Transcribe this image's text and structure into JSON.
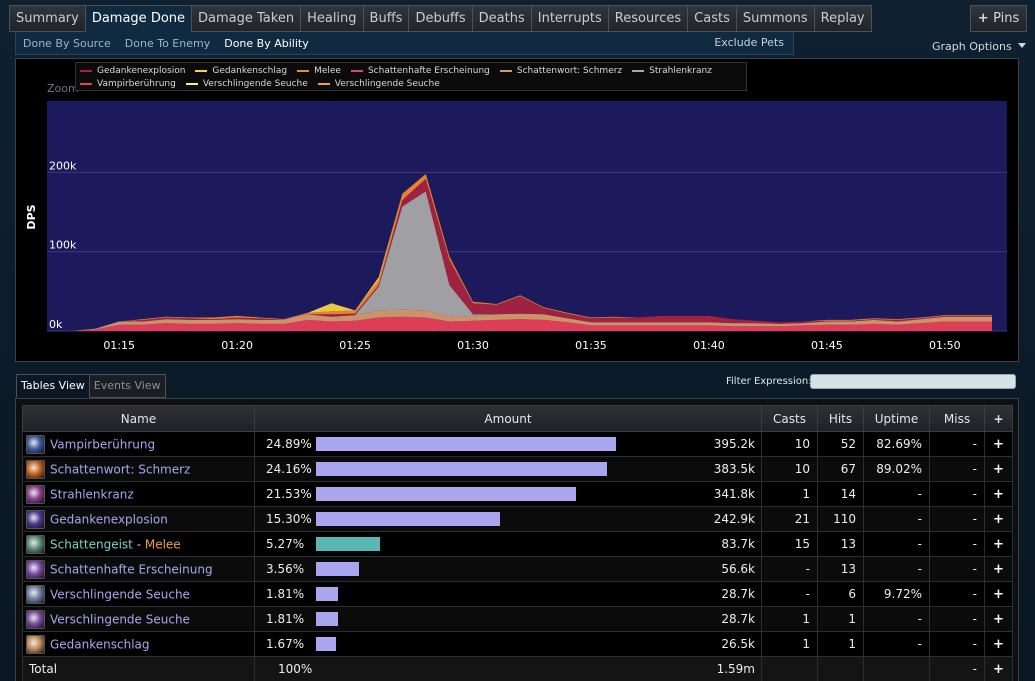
{
  "top_tabs": [
    "Summary",
    "Damage Done",
    "Damage Taken",
    "Healing",
    "Buffs",
    "Debuffs",
    "Deaths",
    "Interrupts",
    "Resources",
    "Casts",
    "Summons",
    "Replay"
  ],
  "active_top_tab": "Damage Done",
  "pins_label": "Pins",
  "sub_tabs": [
    "Done By Source",
    "Done To Enemy",
    "Done By Ability"
  ],
  "active_sub_tab": "Done By Ability",
  "exclude_pets_label": "Exclude Pets",
  "graph_options_label": "Graph Options",
  "view_tabs": {
    "tables": "Tables View",
    "events": "Events View"
  },
  "filter": {
    "label": "Filter Expression:",
    "value": ""
  },
  "graph": {
    "zoom_label": "Zoom",
    "y_label": "DPS",
    "legend": [
      {
        "name": "Gedankenexplosion",
        "color": "#a7243f"
      },
      {
        "name": "Gedankenschlag",
        "color": "#f5d443"
      },
      {
        "name": "Melee",
        "color": "#f08a2a"
      },
      {
        "name": "Schattenhafte Erscheinung",
        "color": "#e0475a"
      },
      {
        "name": "Schattenwort: Schmerz",
        "color": "#d49a6a"
      },
      {
        "name": "Strahlenkranz",
        "color": "#a8a8a8"
      },
      {
        "name": "Vampirberührung",
        "color": "#e83f56"
      },
      {
        "name": "Verschlingende Seuche",
        "color": "#ffee88"
      },
      {
        "name": "Verschlingende Seuche",
        "color": "#f7a034"
      }
    ]
  },
  "chart_data": {
    "type": "area",
    "title": "",
    "xlabel": "",
    "ylabel": "DPS",
    "x_ticks": [
      "01:15",
      "01:20",
      "01:25",
      "01:30",
      "01:35",
      "01:40",
      "01:45",
      "01:50"
    ],
    "y_ticks": [
      "0k",
      "100k",
      "200k"
    ],
    "ylim": [
      0,
      290000
    ],
    "stacked": true,
    "x": [
      "01:13",
      "01:14",
      "01:15",
      "01:16",
      "01:17",
      "01:18",
      "01:19",
      "01:20",
      "01:21",
      "01:22",
      "01:23",
      "01:24",
      "01:25",
      "01:26",
      "01:27",
      "01:28",
      "01:29",
      "01:30",
      "01:31",
      "01:32",
      "01:33",
      "01:34",
      "01:35",
      "01:36",
      "01:37",
      "01:38",
      "01:39",
      "01:40",
      "01:41",
      "01:42",
      "01:43",
      "01:44",
      "01:45",
      "01:46",
      "01:47",
      "01:48",
      "01:49",
      "01:50",
      "01:51",
      "01:52"
    ],
    "series": [
      {
        "name": "Vampirberührung",
        "color": "#e83f56",
        "values": [
          0,
          2000,
          8000,
          8000,
          10000,
          9000,
          9000,
          10000,
          9000,
          9000,
          14000,
          12000,
          13000,
          17000,
          18000,
          17000,
          12000,
          13000,
          14000,
          15000,
          14000,
          11000,
          7000,
          7000,
          7000,
          7000,
          7000,
          7000,
          6000,
          6000,
          6000,
          7000,
          8000,
          8000,
          9000,
          8000,
          10000,
          12000,
          12000,
          12000
        ]
      },
      {
        "name": "Schattenwort: Schmerz",
        "color": "#d49a6a",
        "values": [
          0,
          1000,
          4000,
          4000,
          5000,
          5000,
          5000,
          5000,
          5000,
          5000,
          7000,
          6000,
          7000,
          9000,
          9000,
          9000,
          6000,
          6000,
          7000,
          7000,
          7000,
          5000,
          4000,
          4000,
          4000,
          4000,
          4000,
          4000,
          4000,
          4000,
          3000,
          3000,
          4000,
          4000,
          5000,
          4000,
          5000,
          6000,
          6000,
          6000
        ]
      },
      {
        "name": "Strahlenkranz",
        "color": "#a8a8a8",
        "values": [
          0,
          0,
          0,
          0,
          0,
          0,
          0,
          0,
          0,
          0,
          0,
          0,
          0,
          30000,
          130000,
          150000,
          40000,
          2000,
          0,
          0,
          0,
          0,
          0,
          0,
          0,
          0,
          0,
          0,
          0,
          0,
          0,
          0,
          0,
          0,
          0,
          0,
          0,
          0,
          0,
          0
        ]
      },
      {
        "name": "Gedankenexplosion",
        "color": "#a7243f",
        "values": [
          0,
          0,
          0,
          2000,
          2000,
          2000,
          1000,
          2000,
          2000,
          0,
          0,
          3000,
          2000,
          2000,
          8000,
          16000,
          32000,
          14000,
          12000,
          22000,
          8000,
          6000,
          5000,
          6000,
          6000,
          8000,
          8000,
          8000,
          5000,
          3000,
          2000,
          2000,
          1000,
          1000,
          1000,
          2000,
          1000,
          1000,
          1000,
          1000
        ]
      },
      {
        "name": "Melee",
        "color": "#f08a2a",
        "values": [
          0,
          0,
          0,
          1000,
          1000,
          1000,
          2000,
          2000,
          1000,
          1000,
          2000,
          4000,
          4000,
          6000,
          8000,
          6000,
          4000,
          2000,
          1000,
          1000,
          1000,
          1000,
          1000,
          1000,
          0,
          0,
          0,
          0,
          0,
          0,
          0,
          0,
          1000,
          1000,
          1000,
          1000,
          1000,
          1000,
          1000,
          1000
        ]
      },
      {
        "name": "Gedankenschlag",
        "color": "#f5d443",
        "values": [
          0,
          0,
          0,
          0,
          0,
          0,
          0,
          0,
          0,
          0,
          0,
          10000,
          0,
          4000,
          0,
          0,
          0,
          0,
          0,
          0,
          0,
          0,
          0,
          0,
          0,
          0,
          0,
          0,
          0,
          0,
          0,
          0,
          0,
          0,
          0,
          0,
          0,
          0,
          0,
          0
        ]
      }
    ]
  },
  "table": {
    "headers": {
      "name": "Name",
      "amount": "Amount",
      "casts": "Casts",
      "hits": "Hits",
      "uptime": "Uptime",
      "miss": "Miss",
      "plus": "+"
    },
    "rows": [
      {
        "name": "Vampirberührung",
        "icon": "vampiric-touch-icon",
        "icon_color": "#3c5a9e",
        "pct": "24.89%",
        "fraction": 0.2489,
        "amount": "395.2k",
        "casts": "10",
        "hits": "52",
        "uptime": "82.69%",
        "miss": "-"
      },
      {
        "name": "Schattenwort: Schmerz",
        "icon": "shadow-word-pain-icon",
        "icon_color": "#c7621e",
        "pct": "24.16%",
        "fraction": 0.2416,
        "amount": "383.5k",
        "casts": "10",
        "hits": "67",
        "uptime": "89.02%",
        "miss": "-"
      },
      {
        "name": "Strahlenkranz",
        "icon": "halo-icon",
        "icon_color": "#8a3f8c",
        "pct": "21.53%",
        "fraction": 0.2153,
        "amount": "341.8k",
        "casts": "1",
        "hits": "14",
        "uptime": "-",
        "miss": "-"
      },
      {
        "name": "Gedankenexplosion",
        "icon": "mind-blast-icon",
        "icon_color": "#4b3a8e",
        "pct": "15.30%",
        "fraction": 0.153,
        "amount": "242.9k",
        "casts": "21",
        "hits": "110",
        "uptime": "-",
        "miss": "-"
      },
      {
        "name": "Schattengeist",
        "pet_sep": " - ",
        "sub": "Melee",
        "icon": "shadowfiend-icon",
        "icon_color": "#5a8a74",
        "pct": "5.27%",
        "fraction": 0.0527,
        "amount": "83.7k",
        "casts": "15",
        "hits": "13",
        "uptime": "-",
        "miss": "-",
        "pet": true
      },
      {
        "name": "Schattenhafte Erscheinung",
        "icon": "shadowy-apparition-icon",
        "icon_color": "#7a4aa8",
        "pct": "3.56%",
        "fraction": 0.0356,
        "amount": "56.6k",
        "casts": "-",
        "hits": "13",
        "uptime": "-",
        "miss": "-"
      },
      {
        "name": "Verschlingende Seuche",
        "icon": "devouring-plague-icon",
        "icon_color": "#6b7fa0",
        "pct": "1.81%",
        "fraction": 0.0181,
        "amount": "28.7k",
        "casts": "-",
        "hits": "6",
        "uptime": "9.72%",
        "miss": "-"
      },
      {
        "name": "Verschlingende Seuche",
        "icon": "devouring-plague-icon",
        "icon_color": "#7a4a9e",
        "pct": "1.81%",
        "fraction": 0.0181,
        "amount": "28.7k",
        "casts": "1",
        "hits": "1",
        "uptime": "-",
        "miss": "-"
      },
      {
        "name": "Gedankenschlag",
        "icon": "mind-flay-icon",
        "icon_color": "#c08a5a",
        "pct": "1.67%",
        "fraction": 0.0167,
        "amount": "26.5k",
        "casts": "1",
        "hits": "1",
        "uptime": "-",
        "miss": "-"
      }
    ],
    "total": {
      "label": "Total",
      "pct": "100%",
      "amount": "1.59m",
      "miss": "-"
    }
  }
}
